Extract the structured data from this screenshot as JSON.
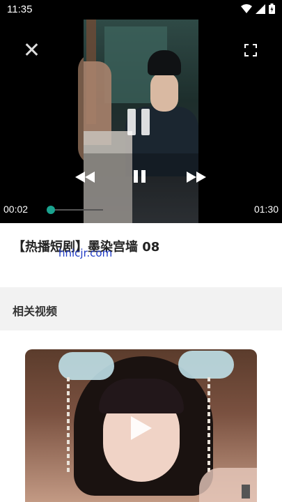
{
  "status_bar": {
    "time": "11:35",
    "icons": [
      "wifi-icon",
      "signal-icon",
      "battery-icon"
    ]
  },
  "player": {
    "current_time": "00:02",
    "total_time": "01:30",
    "progress": 0.022,
    "controls": [
      "close-icon",
      "fullscreen-icon",
      "rewind-icon",
      "pause-icon",
      "fast-forward-icon"
    ],
    "accent_color": "#1aa38f"
  },
  "video": {
    "title": "【热播短剧】墨染宫墙 08",
    "watermark": "hnlcjr.com"
  },
  "related": {
    "header": "相关视频"
  }
}
